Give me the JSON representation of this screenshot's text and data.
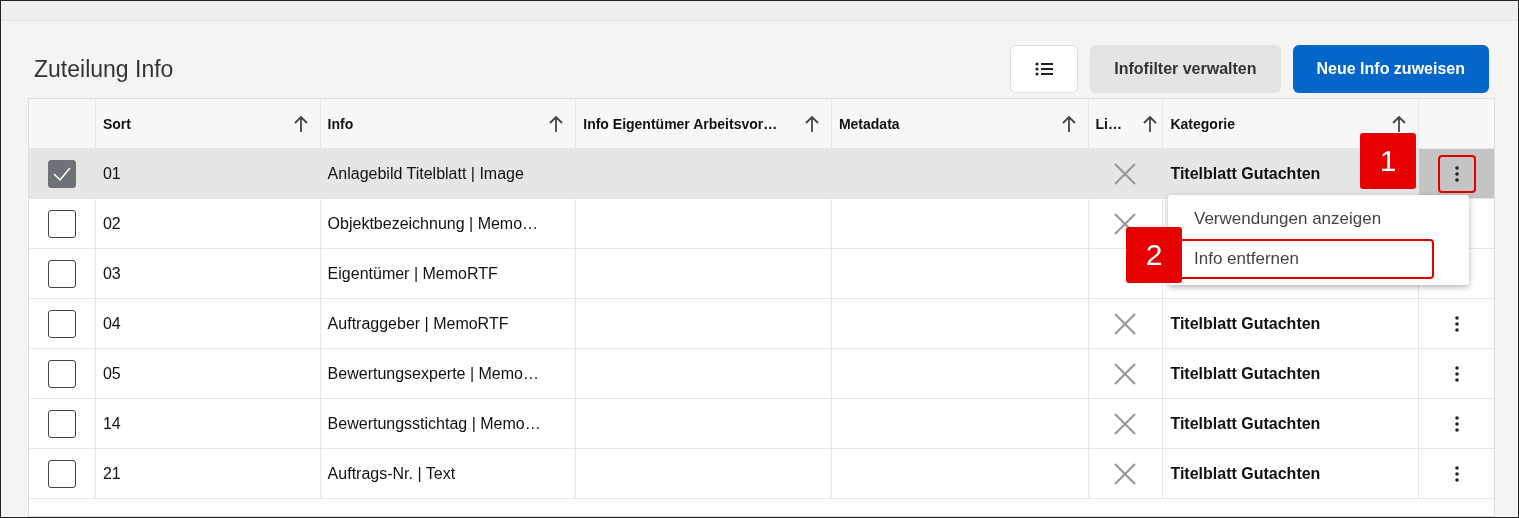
{
  "title": "Zuteilung Info",
  "toolbar": {
    "filter_button": "Infofilter verwalten",
    "primary_button": "Neue Info zuweisen"
  },
  "table": {
    "columns": [
      {
        "label": "Sort"
      },
      {
        "label": "Info"
      },
      {
        "label": "Info Eigentümer Arbeitsvor…"
      },
      {
        "label": "Metadata"
      },
      {
        "label": "Li…"
      },
      {
        "label": "Kategorie"
      }
    ],
    "rows": [
      {
        "checked": true,
        "sort": "01",
        "info": "Anlagebild Titelblatt | Image",
        "cleared": true,
        "kategorie": "Titelblatt Gutachten",
        "actions": true,
        "callout": "1"
      },
      {
        "checked": false,
        "sort": "02",
        "info": "Objektbezeichnung | Memo…",
        "cleared": true,
        "actions": false
      },
      {
        "checked": false,
        "sort": "03",
        "info": "Eigentümer | MemoRTF",
        "cleared": false,
        "actions": false
      },
      {
        "checked": false,
        "sort": "04",
        "info": "Auftraggeber | MemoRTF",
        "cleared": true,
        "kategorie": "Titelblatt Gutachten",
        "actions": true
      },
      {
        "checked": false,
        "sort": "05",
        "info": "Bewertungsexperte | Memo…",
        "cleared": true,
        "kategorie": "Titelblatt Gutachten",
        "actions": true
      },
      {
        "checked": false,
        "sort": "14",
        "info": "Bewertungsstichtag | Memo…",
        "cleared": true,
        "kategorie": "Titelblatt Gutachten",
        "actions": true
      },
      {
        "checked": false,
        "sort": "21",
        "info": "Auftrags-Nr. | Text",
        "cleared": true,
        "kategorie": "Titelblatt Gutachten",
        "actions": true
      }
    ]
  },
  "row_menu": {
    "items": [
      {
        "label": "Verwendungen anzeigen",
        "highlighted": false
      },
      {
        "label": "Info entfernen",
        "highlighted": true,
        "callout": "2"
      }
    ]
  }
}
